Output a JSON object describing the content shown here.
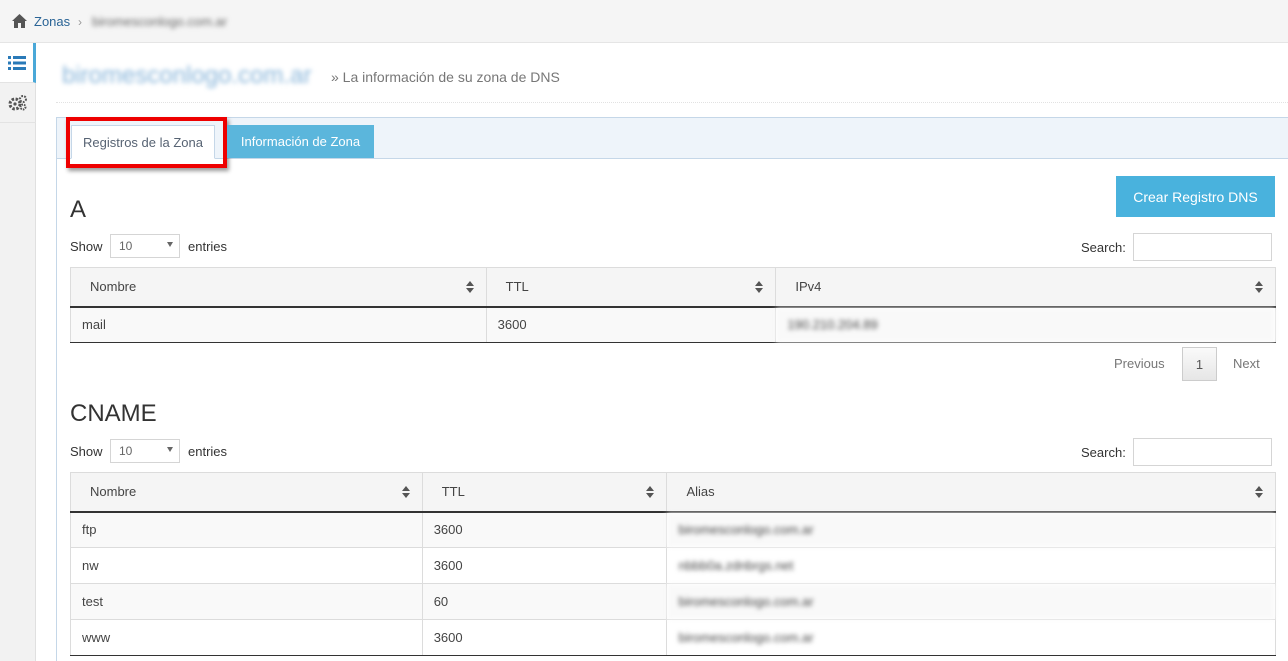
{
  "breadcrumb": {
    "home_icon": "home-icon",
    "zonas": "Zonas",
    "separator": "›",
    "current": "biromesconlogo.com.ar"
  },
  "sidebar": {
    "items": [
      {
        "icon": "list-icon"
      },
      {
        "icon": "gears-icon"
      }
    ]
  },
  "page": {
    "title": "biromesconlogo.com.ar",
    "subtitle": "» La información de su zona de DNS"
  },
  "tabs": [
    {
      "label": "Registros de la Zona",
      "active": true
    },
    {
      "label": "Información de Zona",
      "active": false
    }
  ],
  "create_button": "Crear Registro DNS",
  "colors": {
    "accent": "#49b2dd",
    "link": "#2a6496",
    "highlight": "#ee0000"
  },
  "section_a": {
    "title": "A",
    "show_label": "Show",
    "entries_value": "10",
    "entries_label": "entries",
    "search_label": "Search:",
    "columns": [
      "Nombre",
      "TTL",
      "IPv4"
    ],
    "rows": [
      [
        "mail",
        "3600",
        "190.210.204.89"
      ]
    ],
    "pagination": {
      "previous": "Previous",
      "page": "1",
      "next": "Next"
    }
  },
  "section_cname": {
    "title": "CNAME",
    "show_label": "Show",
    "entries_value": "10",
    "entries_label": "entries",
    "search_label": "Search:",
    "columns": [
      "Nombre",
      "TTL",
      "Alias"
    ],
    "rows": [
      [
        "ftp",
        "3600",
        "biromesconlogo.com.ar"
      ],
      [
        "nw",
        "3600",
        "nbbb0a.zdnbrgs.net"
      ],
      [
        "test",
        "60",
        "biromesconlogo.com.ar"
      ],
      [
        "www",
        "3600",
        "biromesconlogo.com.ar"
      ]
    ]
  }
}
